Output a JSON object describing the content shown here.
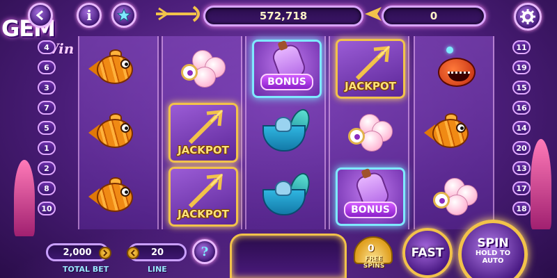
{
  "branding": {
    "logo_main": "GEM",
    "logo_sub": "Win"
  },
  "topbar": {
    "info_label": "i",
    "favorite_icon": "star-icon",
    "balance": "572,718",
    "win_amount": "0",
    "settings_icon": "gear-icon"
  },
  "lines_left": [
    "4",
    "6",
    "3",
    "7",
    "5",
    "1",
    "2",
    "8",
    "10"
  ],
  "lines_right": [
    "11",
    "19",
    "15",
    "16",
    "14",
    "20",
    "13",
    "17",
    "18"
  ],
  "reels": [
    [
      "fish",
      "fish",
      "fish"
    ],
    [
      "shell",
      "jackpot",
      "jackpot"
    ],
    [
      "bonus",
      "cup",
      "cup"
    ],
    [
      "jackpot",
      "shell",
      "bonus"
    ],
    [
      "angler",
      "fish",
      "shell"
    ]
  ],
  "symbol_labels": {
    "jackpot": "JACKPOT",
    "bonus": "BONUS"
  },
  "bottom": {
    "total_bet_value": "2,000",
    "total_bet_label": "TOTAL BET",
    "line_value": "20",
    "line_label": "LINE",
    "help_label": "?",
    "free_spins_count": "0",
    "free_spins_label": "FREE SPINS",
    "fast_label": "FAST",
    "spin_label": "SPIN",
    "spin_sub_label": "HOLD TO AUTO"
  },
  "colors": {
    "accent_gold": "#f2c24a",
    "frame_purple": "#d9a5ff",
    "bonus_glow": "#7fe9ff"
  }
}
